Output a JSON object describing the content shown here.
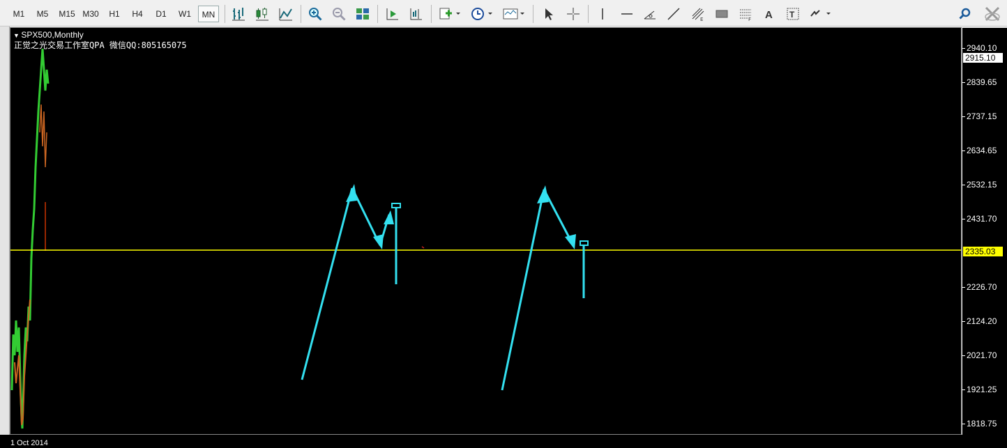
{
  "toolbar": {
    "timeframes": [
      "M1",
      "M5",
      "M15",
      "M30",
      "H1",
      "H4",
      "D1",
      "W1",
      "MN"
    ],
    "active_timeframe": "MN",
    "icons": [
      "bar-chart-icon",
      "candlestick-chart-icon",
      "line-chart-icon",
      "zoom-in-icon",
      "zoom-out-icon",
      "tile-windows-icon",
      "auto-scroll-icon",
      "chart-shift-icon",
      "indicators-icon",
      "periods-icon",
      "templates-icon",
      "cursor-icon",
      "crosshair-icon",
      "vertical-line-icon",
      "horizontal-line-icon",
      "angle-line-icon",
      "trendline-icon",
      "fibonacci-icon",
      "rectangle-icon",
      "fibo-channel-icon",
      "text-icon",
      "text-label-icon",
      "arrows-icon",
      "search-icon",
      "close-icon"
    ]
  },
  "chart": {
    "symbol_label": "SPX500,Monthly",
    "info_text": "正觉之光交易工作室QPA 微信QQ:805165075",
    "current_price": "2335.03",
    "top_price_box": "2915.10",
    "price_ticks": [
      "2940.10",
      "2839.65",
      "2737.15",
      "2634.65",
      "2532.15",
      "2431.70",
      "2226.70",
      "2124.20",
      "2021.70",
      "1921.25",
      "1818.75"
    ],
    "date_label": "1 Oct 2014",
    "colors": {
      "background": "#000000",
      "price_line": "#ffff00",
      "annotation": "#33e0f0",
      "bull": "#33cc33",
      "bear": "#cc3300"
    }
  }
}
